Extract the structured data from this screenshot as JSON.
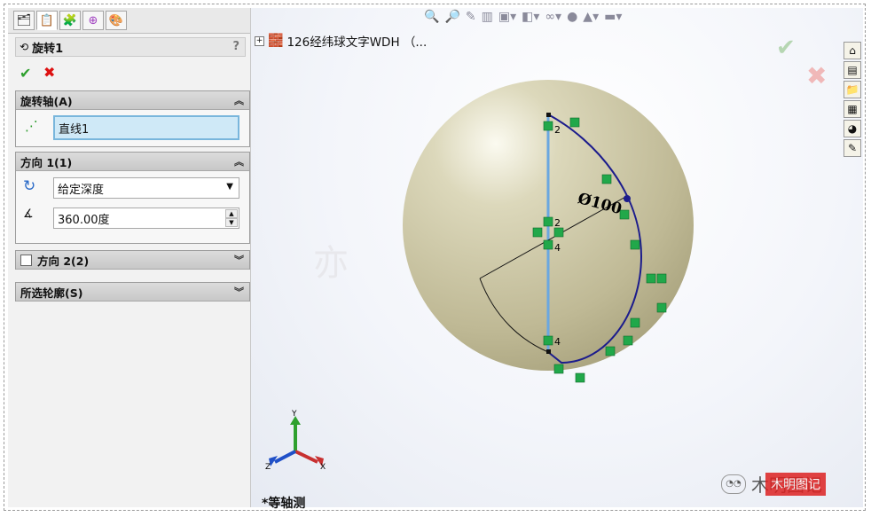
{
  "property_manager": {
    "feature_title": "旋转1",
    "help": "?",
    "sections": {
      "axis": {
        "title": "旋转轴(A)",
        "value": "直线1"
      },
      "direction1": {
        "title": "方向 1(1)",
        "end_condition": "给定深度",
        "angle": "360.00度"
      },
      "direction2": {
        "title": "方向 2(2)"
      },
      "contours": {
        "title": "所选轮廓(S)"
      }
    }
  },
  "graphics": {
    "tree_node": "126经纬球文字WDH （...",
    "view_name": "*等轴测",
    "dimension": "Ø100",
    "point_labels": [
      "2",
      "2",
      "4",
      "4"
    ],
    "triad": {
      "x": "X",
      "y": "Y",
      "z": "Z"
    }
  },
  "watermark": {
    "text": "木明图记",
    "seal": "木明图记"
  },
  "colors": {
    "sketch": "#1c1c8c",
    "axis_line": "#6aa7e0",
    "relation": "#21a84a",
    "sphere": "#cfcaa7"
  }
}
